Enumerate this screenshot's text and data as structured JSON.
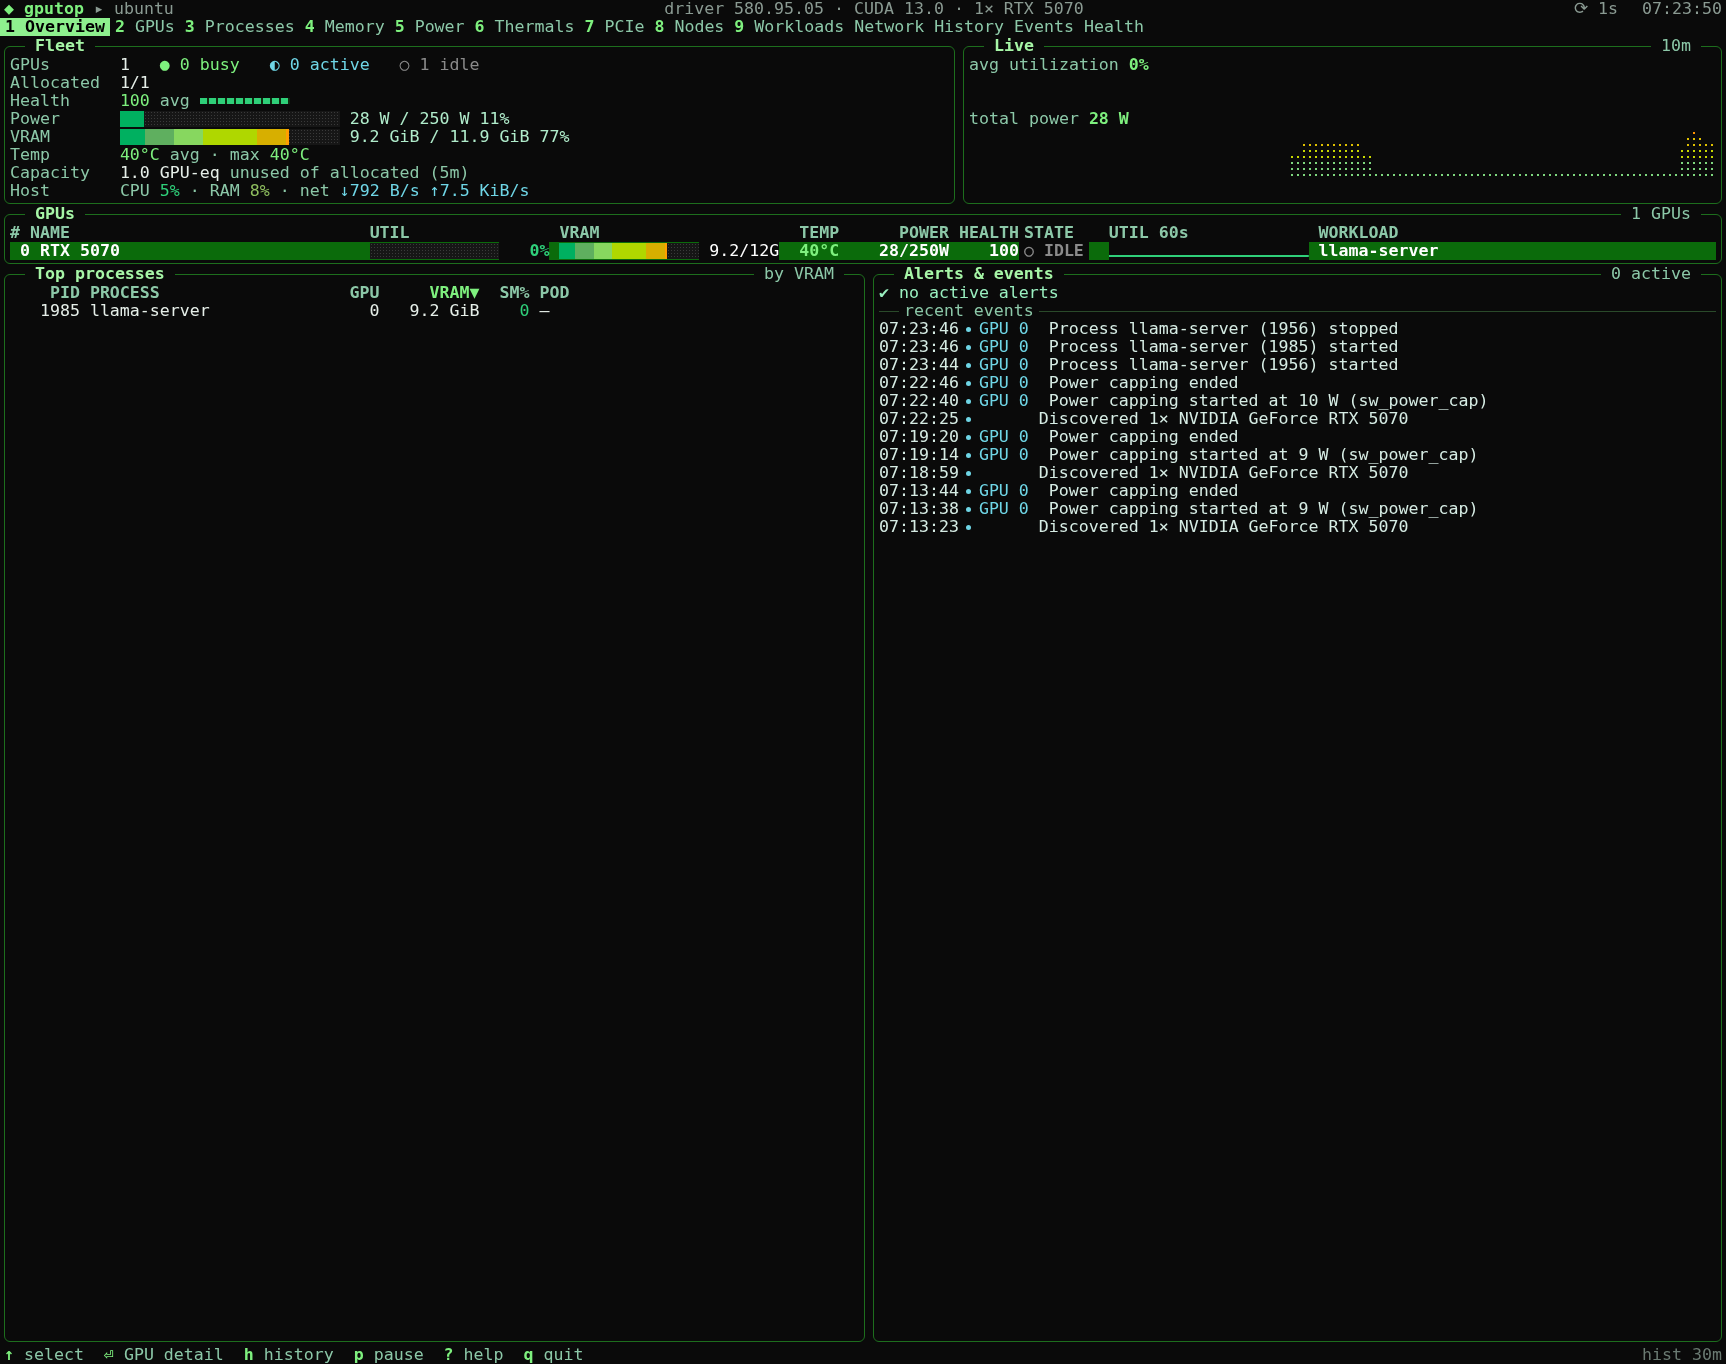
{
  "header": {
    "brand": "◆ gputop",
    "host": "▸ ubuntu",
    "info": "driver 580.95.05 · CUDA 13.0 · 1× RTX 5070",
    "refresh": "⟳ 1s",
    "clock": "07:23:50"
  },
  "tabs": [
    {
      "key": "1",
      "label": "Overview",
      "selected": true
    },
    {
      "key": "2",
      "label": "GPUs",
      "selected": false
    },
    {
      "key": "3",
      "label": "Processes",
      "selected": false
    },
    {
      "key": "4",
      "label": "Memory",
      "selected": false
    },
    {
      "key": "5",
      "label": "Power",
      "selected": false
    },
    {
      "key": "6",
      "label": "Thermals",
      "selected": false
    },
    {
      "key": "7",
      "label": "PCIe",
      "selected": false
    },
    {
      "key": "8",
      "label": "Nodes",
      "selected": false
    },
    {
      "key": "9",
      "label": "Workloads",
      "selected": false
    },
    {
      "label": "Network",
      "selected": false
    },
    {
      "label": "History",
      "selected": false
    },
    {
      "label": "Events",
      "selected": false
    },
    {
      "label": "Health",
      "selected": false
    }
  ],
  "fleet": {
    "title": "Fleet",
    "rows": [
      {
        "kind": "counts",
        "label": "GPUs",
        "value": "1",
        "items": [
          {
            "kind": "busy",
            "text": "● 0 busy"
          },
          {
            "kind": "active",
            "text": "◐ 0 active"
          },
          {
            "kind": "idle",
            "text": "○ 1 idle"
          }
        ]
      },
      {
        "kind": "text",
        "label": "Allocated",
        "parts": [
          {
            "kind": "value",
            "text": "1/1"
          }
        ]
      },
      {
        "kind": "meter",
        "label": "Health",
        "parts": [
          {
            "kind": "hi",
            "text": "100"
          },
          {
            "kind": "muted",
            "text": "avg"
          }
        ],
        "level": 1.0
      },
      {
        "kind": "bar",
        "label": "Power",
        "level": 0.11,
        "reading": "28 W / 250 W 11%"
      },
      {
        "kind": "gradient_bar",
        "label": "VRAM",
        "level": 0.77,
        "reading": "9.2 GiB / 11.9 GiB 77%"
      },
      {
        "kind": "text",
        "label": "Temp",
        "parts": [
          {
            "kind": "hi",
            "text": "40°C"
          },
          {
            "kind": "muted",
            "text": "avg · max"
          },
          {
            "kind": "hi",
            "text": "40°C"
          }
        ]
      },
      {
        "kind": "text",
        "label": "Capacity",
        "parts": [
          {
            "kind": "value",
            "text": "1.0 GPU-eq"
          },
          {
            "kind": "muted",
            "text": "unused of allocated (5m)"
          }
        ]
      },
      {
        "kind": "text",
        "label": "Host",
        "parts": [
          {
            "kind": "muted",
            "text": "CPU"
          },
          {
            "kind": "good",
            "text": "5%"
          },
          {
            "kind": "muted",
            "text": "· RAM"
          },
          {
            "kind": "fair",
            "text": "8%"
          },
          {
            "kind": "muted",
            "text": "· net"
          },
          {
            "kind": "accent",
            "text": "↓792 B/s"
          },
          {
            "kind": "accent",
            "text": "↑7.5 KiB/s"
          }
        ]
      }
    ]
  },
  "live": {
    "title": "Live",
    "caption": "10m",
    "utilization_label": "avg utilization",
    "utilization": "0%",
    "power_label": "total power",
    "power": "28 W"
  },
  "gpus": {
    "title": "GPUs",
    "caption": "1 GPUs",
    "columns": [
      "#",
      "NAME",
      "UTIL",
      "VRAM",
      "TEMP",
      "POWER",
      "HEALTH",
      "STATE",
      "UTIL 60s",
      "WORKLOAD"
    ],
    "rows": [
      {
        "index": "0",
        "name": "RTX 5070",
        "util": {
          "level": 0.0,
          "reading": "0%"
        },
        "vram": {
          "level": 0.77,
          "reading": "9.2/12G"
        },
        "temp": "40°C",
        "power": "28/250W",
        "health": "100",
        "state": "○ IDLE",
        "workload": "llama-server",
        "selected": true
      }
    ]
  },
  "processes": {
    "title": "Top processes",
    "caption": "by VRAM",
    "columns": [
      {
        "label": "PID",
        "sorted": false
      },
      {
        "label": "PROCESS",
        "sorted": false
      },
      {
        "label": "GPU",
        "sorted": false
      },
      {
        "label": "VRAM▼",
        "sorted": true
      },
      {
        "label": "SM%",
        "sorted": false
      },
      {
        "label": "POD",
        "sorted": false
      }
    ],
    "rows": [
      [
        "1985",
        "llama-server",
        "0",
        "9.2 GiB",
        "0",
        "–"
      ]
    ]
  },
  "alerts": {
    "title": "Alerts & events",
    "caption": "0 active",
    "status": "✔ no active alerts",
    "section": "recent events",
    "events": [
      {
        "time": "07:23:46",
        "gpu": "GPU 0",
        "message": "Process llama-server (1956) stopped"
      },
      {
        "time": "07:23:46",
        "gpu": "GPU 0",
        "message": "Process llama-server (1985) started"
      },
      {
        "time": "07:23:44",
        "gpu": "GPU 0",
        "message": "Process llama-server (1956) started"
      },
      {
        "time": "07:22:46",
        "gpu": "GPU 0",
        "message": "Power capping ended"
      },
      {
        "time": "07:22:40",
        "gpu": "GPU 0",
        "message": "Power capping started at 10 W (sw_power_cap)"
      },
      {
        "time": "07:22:25",
        "message": "Discovered 1× NVIDIA GeForce RTX 5070"
      },
      {
        "time": "07:19:20",
        "gpu": "GPU 0",
        "message": "Power capping ended"
      },
      {
        "time": "07:19:14",
        "gpu": "GPU 0",
        "message": "Power capping started at 9 W (sw_power_cap)"
      },
      {
        "time": "07:18:59",
        "message": "Discovered 1× NVIDIA GeForce RTX 5070"
      },
      {
        "time": "07:13:44",
        "gpu": "GPU 0",
        "message": "Power capping ended"
      },
      {
        "time": "07:13:38",
        "gpu": "GPU 0",
        "message": "Power capping started at 9 W (sw_power_cap)"
      },
      {
        "time": "07:13:23",
        "message": "Discovered 1× NVIDIA GeForce RTX 5070"
      }
    ]
  },
  "footer": {
    "hints": [
      {
        "key": "↑",
        "label": "select"
      },
      {
        "key": "⏎",
        "label": "GPU detail"
      },
      {
        "key": "h",
        "label": "history"
      },
      {
        "key": "p",
        "label": "pause"
      },
      {
        "key": "?",
        "label": "help"
      },
      {
        "key": "q",
        "label": "quit"
      }
    ],
    "right": "hist 30m"
  }
}
